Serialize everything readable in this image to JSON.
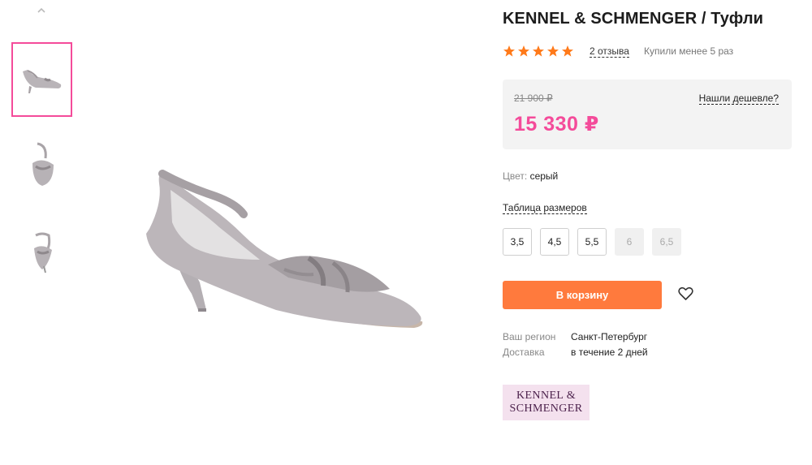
{
  "gallery": {
    "scroll_up_icon": "chevron-up-icon",
    "thumbnails": [
      "shoe-side-thumbnail",
      "shoe-back-thumbnail",
      "shoe-front-thumbnail"
    ],
    "active_index": 0
  },
  "product": {
    "title": "KENNEL & SCHMENGER / Туфли",
    "rating": 5,
    "reviews_label": "2 отзыва",
    "bought_label": "Купили менее 5 раз"
  },
  "price": {
    "old": "21 900 ₽",
    "current": "15 330 ₽",
    "cheaper_link": "Нашли дешевле?"
  },
  "color": {
    "label": "Цвет:",
    "value": "серый"
  },
  "sizes": {
    "table_link": "Таблица размеров",
    "options": [
      {
        "label": "3,5",
        "available": true
      },
      {
        "label": "4,5",
        "available": true
      },
      {
        "label": "5,5",
        "available": true
      },
      {
        "label": "6",
        "available": false
      },
      {
        "label": "6,5",
        "available": false
      }
    ]
  },
  "actions": {
    "cart_label": "В корзину",
    "favorite_icon": "heart-icon"
  },
  "delivery": {
    "region_label": "Ваш регион",
    "region_value": "Санкт-Петербург",
    "delivery_label": "Доставка",
    "delivery_value": "в течение 2 дней"
  },
  "brand": {
    "logo_line1": "KENNEL &",
    "logo_line2": "SCHMENGER"
  },
  "colors": {
    "accent_pink": "#f44b9a",
    "cta_orange": "#ff7a3d",
    "star_orange": "#ff7a1a",
    "brand_bg": "#f4e1ee"
  }
}
